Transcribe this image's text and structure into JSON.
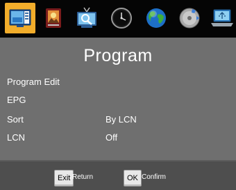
{
  "window": {
    "title": "Program"
  },
  "tabs": [
    {
      "icon": "program-tv-icon",
      "active": true
    },
    {
      "icon": "picture-icon",
      "active": false
    },
    {
      "icon": "channel-search-icon",
      "active": false
    },
    {
      "icon": "clock-icon",
      "active": false
    },
    {
      "icon": "globe-language-icon",
      "active": false
    },
    {
      "icon": "settings-disc-icon",
      "active": false
    },
    {
      "icon": "usb-laptop-icon",
      "active": false
    }
  ],
  "menu": {
    "items": [
      {
        "label": "Program Edit",
        "value": ""
      },
      {
        "label": "EPG",
        "value": ""
      },
      {
        "label": "Sort",
        "value": "By LCN"
      },
      {
        "label": "LCN",
        "value": "Off"
      }
    ]
  },
  "footer": {
    "exit_key": "Exit",
    "exit_hint": "Return",
    "ok_key": "OK",
    "ok_hint": "Confirm"
  },
  "colors": {
    "accent": "#f2ad2b",
    "background": "#6f6f6f",
    "topbar": "#050505",
    "footer": "#4e4e4e"
  }
}
